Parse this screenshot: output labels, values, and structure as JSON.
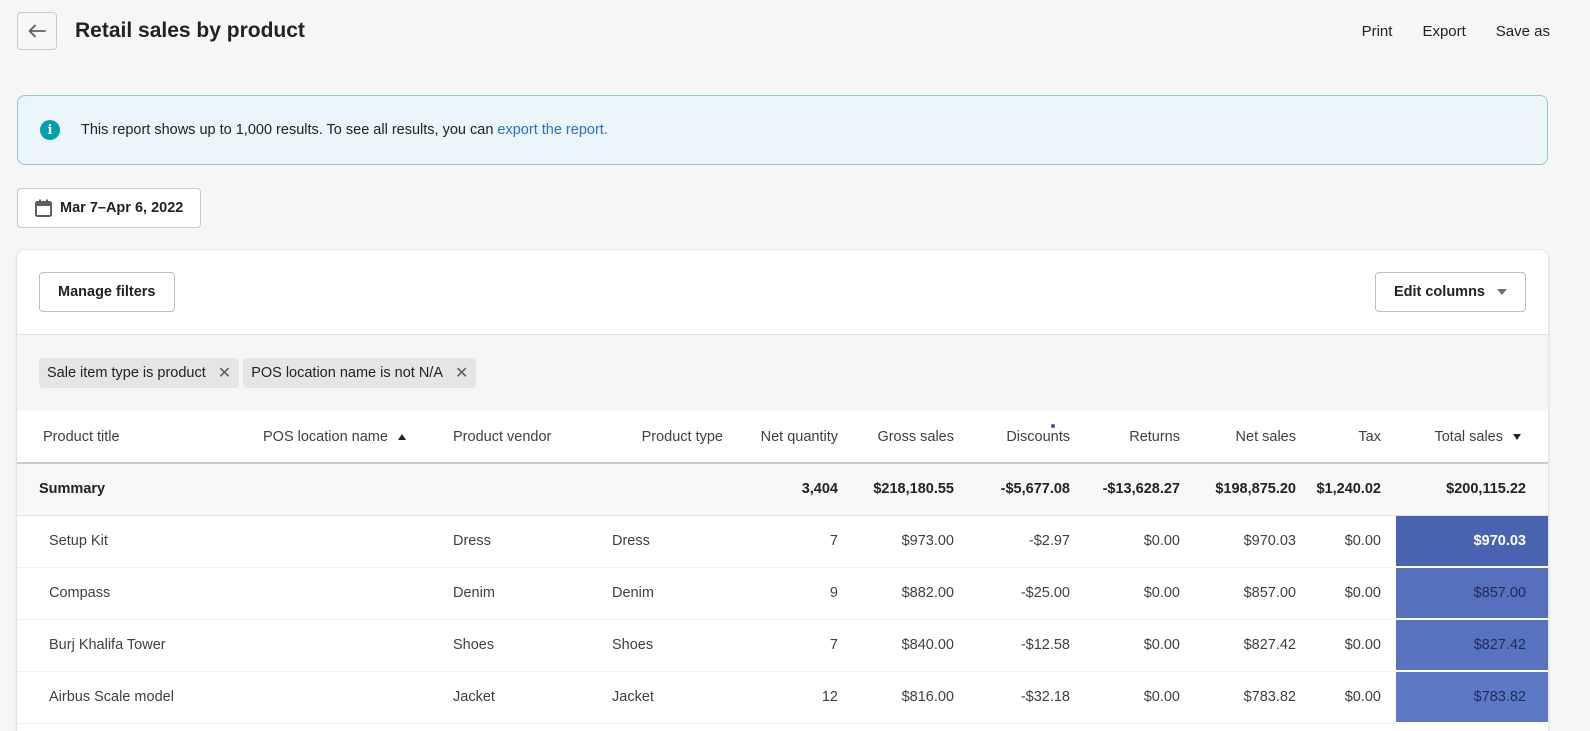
{
  "header": {
    "title": "Retail sales by product",
    "actions": [
      "Print",
      "Export",
      "Save as"
    ]
  },
  "banner": {
    "text": "This report shows up to 1,000 results. To see all results, you can ",
    "link": "export the report."
  },
  "date_range": "Mar 7–Apr 6, 2022",
  "toolbar": {
    "manage_filters": "Manage filters",
    "edit_columns": "Edit columns"
  },
  "filters": [
    "Sale item type is product",
    "POS location name is not N/A"
  ],
  "table": {
    "columns": [
      "Product title",
      "POS location name",
      "Product vendor",
      "Product type",
      "Net quantity",
      "Gross sales",
      "Discounts",
      "Returns",
      "Net sales",
      "Tax",
      "Total sales"
    ],
    "sort": {
      "ascending_column": "POS location name",
      "descending_column": "Total sales"
    },
    "summary": {
      "label": "Summary",
      "net_quantity": "3,404",
      "gross_sales": "$218,180.55",
      "discounts": "-$5,677.08",
      "returns": "-$13,628.27",
      "net_sales": "$198,875.20",
      "tax": "$1,240.02",
      "total_sales": "$200,115.22"
    },
    "rows": [
      {
        "product_title": "Setup Kit",
        "pos_location": "",
        "vendor": "Dress",
        "type": "Dress",
        "net_quantity": "7",
        "gross_sales": "$973.00",
        "discounts": "-$2.97",
        "returns": "$0.00",
        "net_sales": "$970.03",
        "tax": "$0.00",
        "total_sales": "$970.03",
        "heat_color": "#4a63b0"
      },
      {
        "product_title": "Compass",
        "pos_location": "",
        "vendor": "Denim",
        "type": "Denim",
        "net_quantity": "9",
        "gross_sales": "$882.00",
        "discounts": "-$25.00",
        "returns": "$0.00",
        "net_sales": "$857.00",
        "tax": "$0.00",
        "total_sales": "$857.00",
        "heat_color": "#5670bd"
      },
      {
        "product_title": "Burj Khalifa Tower",
        "pos_location": "",
        "vendor": "Shoes",
        "type": "Shoes",
        "net_quantity": "7",
        "gross_sales": "$840.00",
        "discounts": "-$12.58",
        "returns": "$0.00",
        "net_sales": "$827.42",
        "tax": "$0.00",
        "total_sales": "$827.42",
        "heat_color": "#5873c0"
      },
      {
        "product_title": "Airbus Scale model",
        "pos_location": "",
        "vendor": "Jacket",
        "type": "Jacket",
        "net_quantity": "12",
        "gross_sales": "$816.00",
        "discounts": "-$32.18",
        "returns": "$0.00",
        "net_sales": "$783.82",
        "tax": "$0.00",
        "total_sales": "$783.82",
        "heat_color": "#5c79c6"
      }
    ]
  }
}
